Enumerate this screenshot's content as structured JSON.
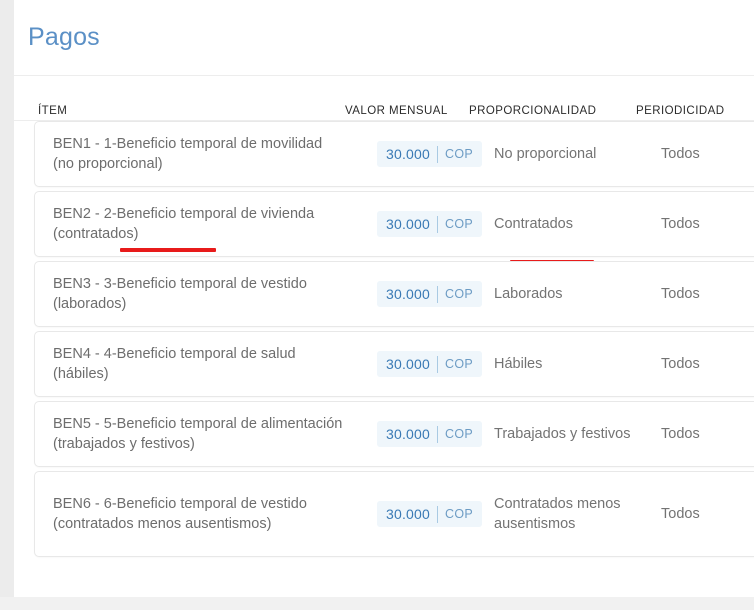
{
  "header": {
    "title": "Pagos"
  },
  "table": {
    "columns": [
      {
        "key": "item",
        "label": "ÍTEM"
      },
      {
        "key": "valor",
        "label": "VALOR MENSUAL"
      },
      {
        "key": "prop",
        "label": "PROPORCIONALIDAD"
      },
      {
        "key": "per",
        "label": "PERIODICIDAD"
      }
    ],
    "rows": [
      {
        "item": "BEN1 - 1-Beneficio temporal de movilidad (no proporcional)",
        "amount": "30.000",
        "currency": "COP",
        "proporcionalidad": "No proporcional",
        "periodicidad": "Todos",
        "annotated_item": false,
        "annotated_prop": false,
        "tall": false
      },
      {
        "item": "BEN2 - 2-Beneficio temporal de vivienda (contratados)",
        "amount": "30.000",
        "currency": "COP",
        "proporcionalidad": "Contratados",
        "periodicidad": "Todos",
        "annotated_item": true,
        "annotated_prop": true,
        "tall": false
      },
      {
        "item": "BEN3 - 3-Beneficio temporal de vestido (laborados)",
        "amount": "30.000",
        "currency": "COP",
        "proporcionalidad": "Laborados",
        "periodicidad": "Todos",
        "annotated_item": false,
        "annotated_prop": false,
        "tall": false
      },
      {
        "item": "BEN4 - 4-Beneficio temporal de salud (hábiles)",
        "amount": "30.000",
        "currency": "COP",
        "proporcionalidad": "Hábiles",
        "periodicidad": "Todos",
        "annotated_item": false,
        "annotated_prop": false,
        "tall": false
      },
      {
        "item": "BEN5 - 5-Beneficio temporal de alimentación (trabajados y festivos)",
        "amount": "30.000",
        "currency": "COP",
        "proporcionalidad": "Trabajados y festivos",
        "periodicidad": "Todos",
        "annotated_item": false,
        "annotated_prop": false,
        "tall": false
      },
      {
        "item": "BEN6 - 6-Beneficio temporal de vestido (contratados menos ausentismos)",
        "amount": "30.000",
        "currency": "COP",
        "proporcionalidad": "Contratados menos ausentismos",
        "periodicidad": "Todos",
        "annotated_item": false,
        "annotated_prop": false,
        "tall": true
      }
    ]
  },
  "colors": {
    "title": "#5b90c6",
    "chip_bg": "#eff6fb",
    "chip_amount": "#3a7ab5",
    "chip_currency": "#6d9cc4",
    "annotation": "#e81b1b",
    "row_text": "#6d6d6d"
  }
}
